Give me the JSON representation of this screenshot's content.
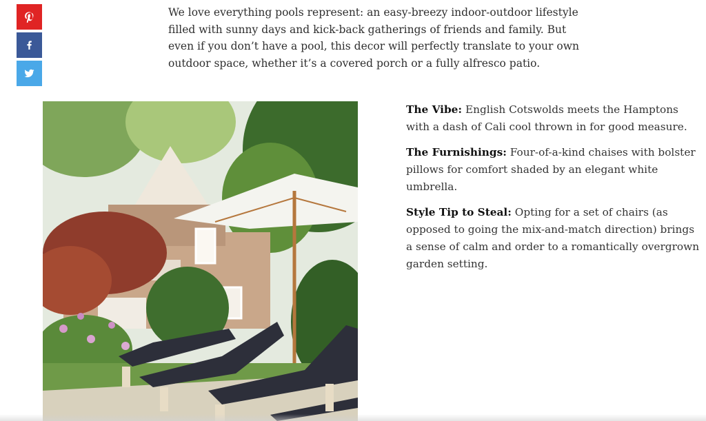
{
  "share": {
    "buttons": [
      {
        "icon": "pinterest-icon",
        "color": "#e02424"
      },
      {
        "icon": "facebook-icon",
        "color": "#3b5998"
      },
      {
        "icon": "twitter-icon",
        "color": "#4aa8e8"
      }
    ]
  },
  "article": {
    "intro": "We love everything pools represent: an easy-breezy indoor-outdoor lifestyle filled with sunny days and kick-back gatherings of friends and family. But even if you don’t have a pool, this decor will perfectly translate to your own outdoor space, whether it’s a covered porch or a fully alfresco patio.",
    "details": [
      {
        "label": "The Vibe:",
        "text": "English Cotswolds meets the Hamptons with a dash of Cali cool thrown in for good measure."
      },
      {
        "label": "The Furnishings:",
        "text": "Four-of-a-kind chaises with bolster pillows for comfort shaded by an elegant white umbrella."
      },
      {
        "label": "Style Tip to Steal:",
        "text": "Opting for a set of chairs (as opposed to going the mix-and-match direction) brings a sense of calm and order to a romantically overgrown garden setting."
      }
    ]
  }
}
